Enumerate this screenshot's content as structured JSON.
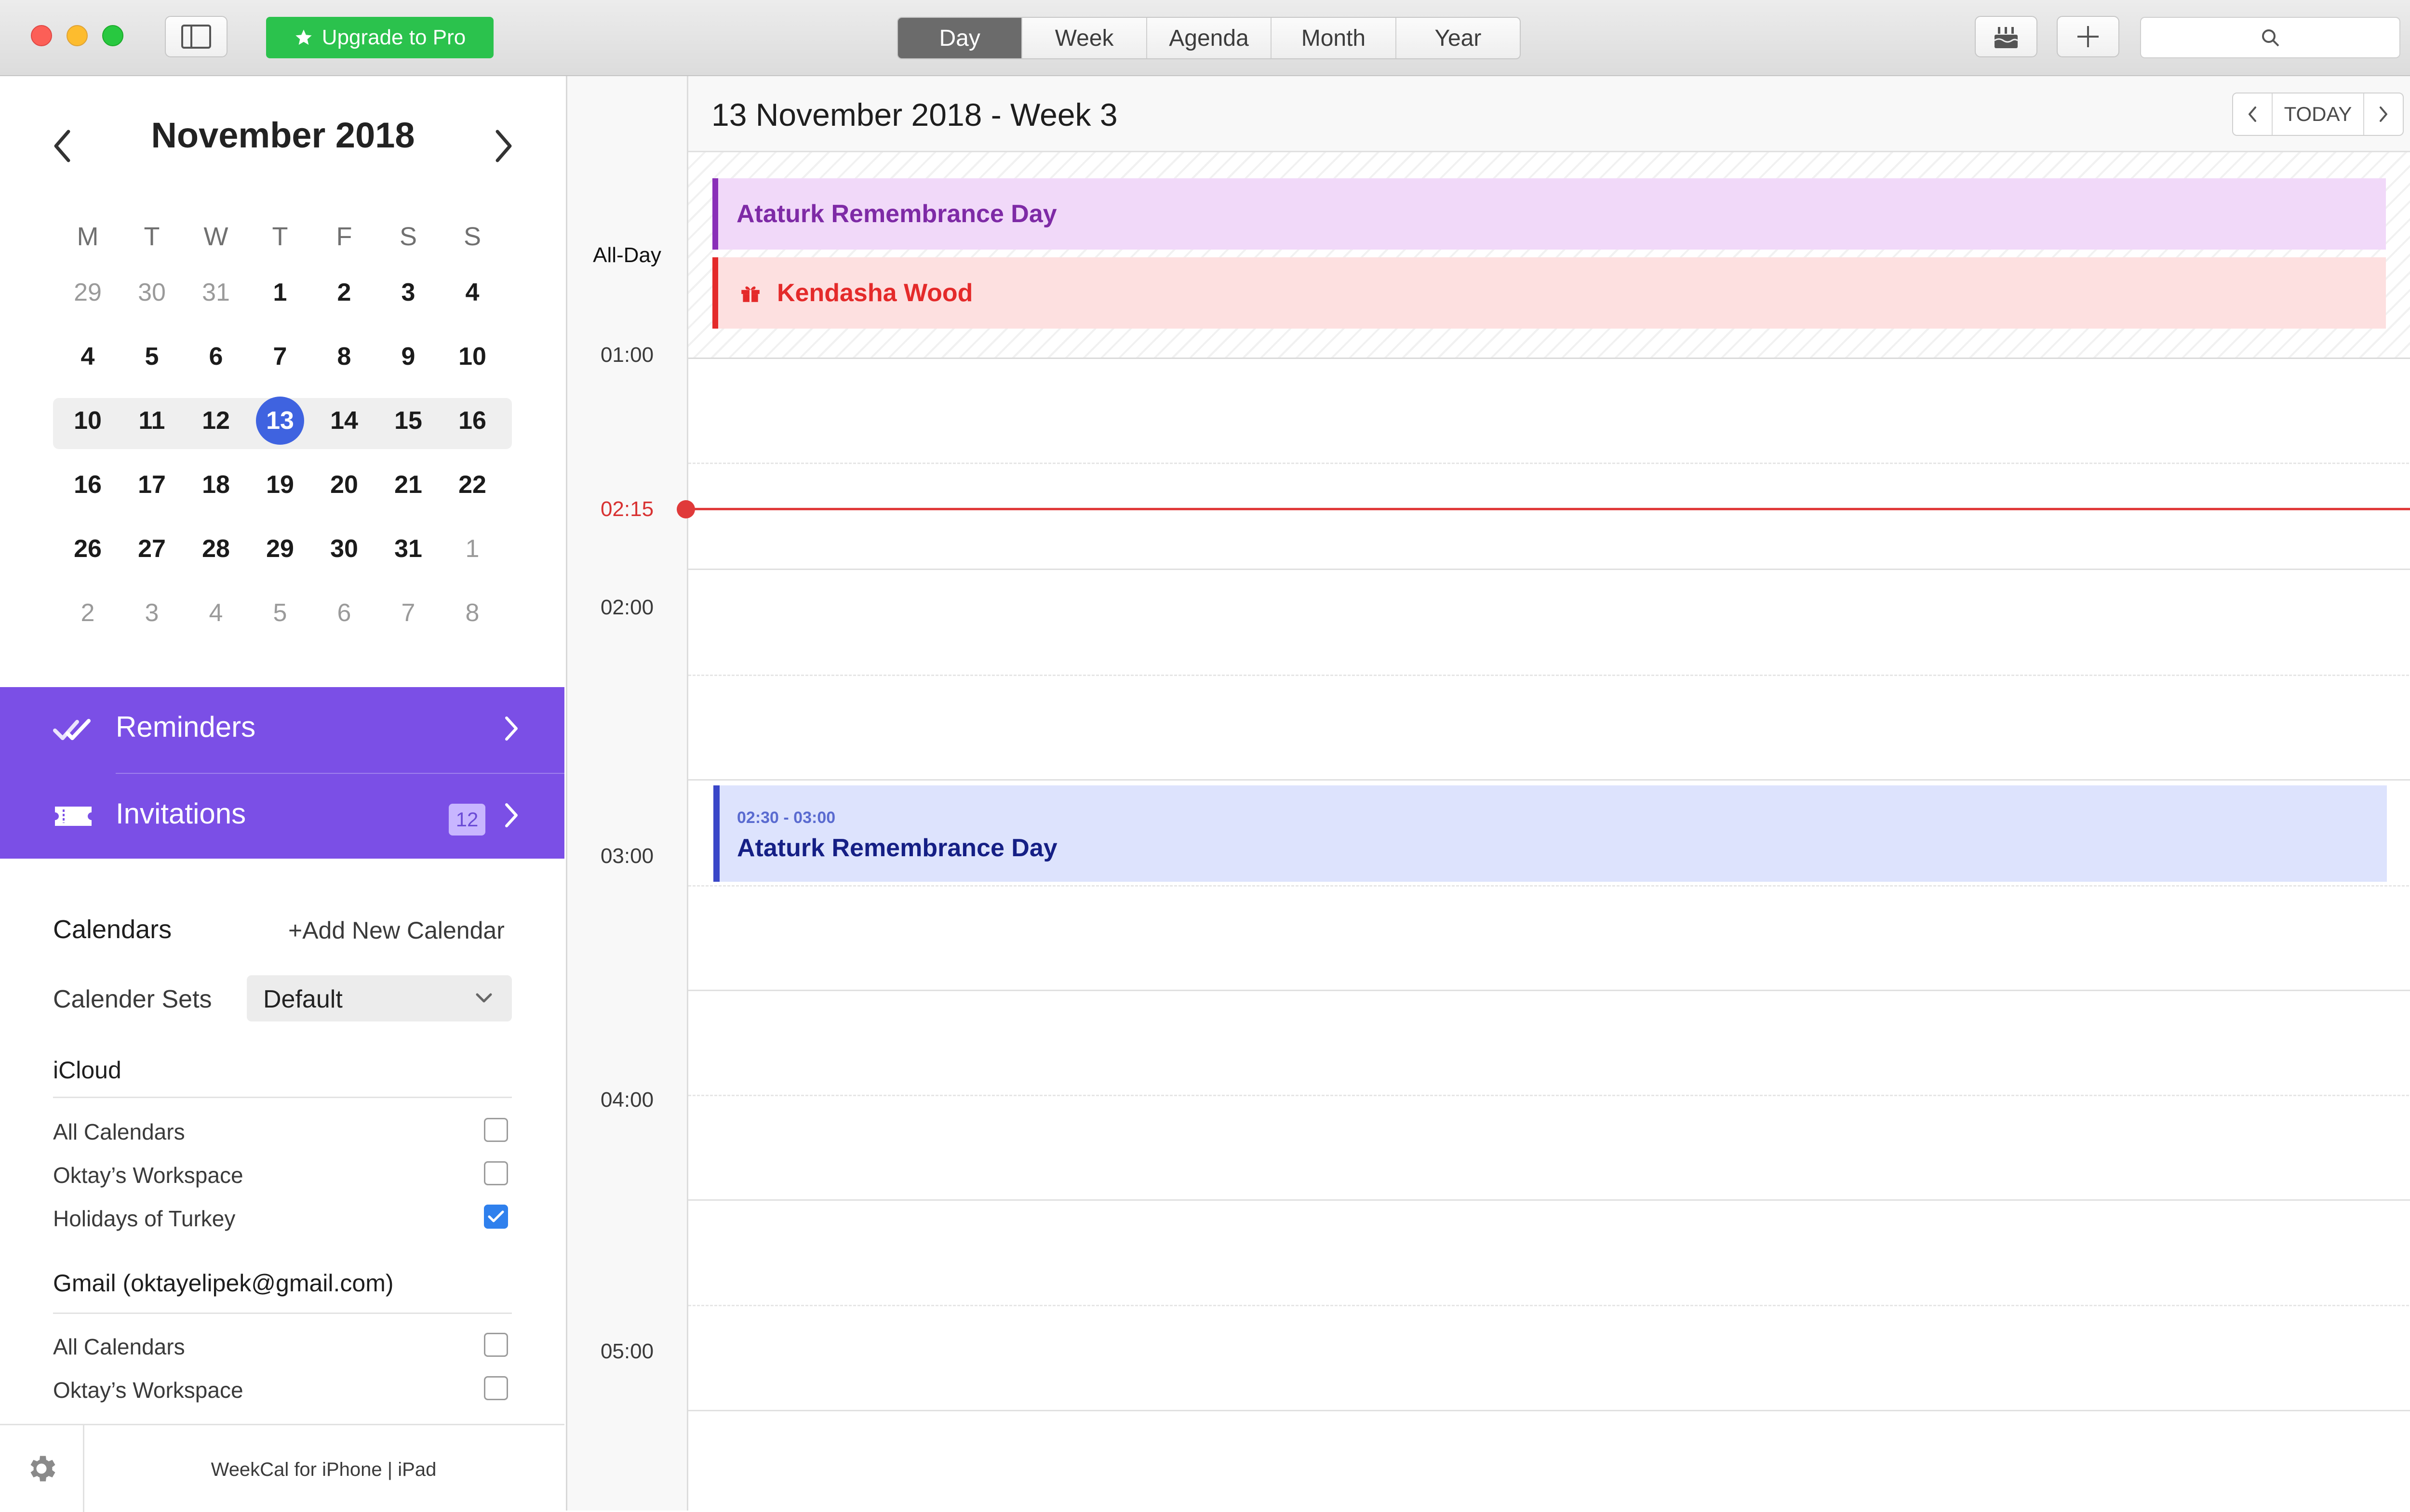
{
  "toolbar": {
    "upgrade_label": "Upgrade to Pro",
    "views": [
      "Day",
      "Week",
      "Agenda",
      "Month",
      "Year"
    ],
    "active_view": "Day"
  },
  "mini_calendar": {
    "title": "November 2018",
    "weekdays": [
      "M",
      "T",
      "W",
      "T",
      "F",
      "S",
      "S"
    ],
    "weeks": [
      [
        "29",
        "30",
        "31",
        "1",
        "2",
        "3",
        "4"
      ],
      [
        "4",
        "5",
        "6",
        "7",
        "8",
        "9",
        "10"
      ],
      [
        "10",
        "11",
        "12",
        "13",
        "14",
        "15",
        "16"
      ],
      [
        "16",
        "17",
        "18",
        "19",
        "20",
        "21",
        "22"
      ],
      [
        "26",
        "27",
        "28",
        "29",
        "30",
        "31",
        "1"
      ],
      [
        "2",
        "3",
        "4",
        "5",
        "6",
        "7",
        "8"
      ]
    ],
    "selected_day": "13"
  },
  "shortcuts": {
    "reminders_label": "Reminders",
    "invitations_label": "Invitations",
    "invitations_count": "12"
  },
  "calendars": {
    "title": "Calendars",
    "add_label": "+Add New Calendar",
    "sets_label": "Calender Sets",
    "sets_value": "Default",
    "accounts": [
      {
        "name": "iCloud",
        "items": [
          {
            "label": "All Calendars",
            "checked": false
          },
          {
            "label": "Oktay’s Workspace",
            "checked": false
          },
          {
            "label": "Holidays of Turkey",
            "checked": true
          }
        ]
      },
      {
        "name": "Gmail (oktayelipek@gmail.com)",
        "items": [
          {
            "label": "All Calendars",
            "checked": false
          },
          {
            "label": "Oktay’s Workspace",
            "checked": false
          }
        ]
      }
    ]
  },
  "footer": {
    "text": "WeekCal for iPhone  |  iPad"
  },
  "day_view": {
    "title": "13 November 2018 - Week 3",
    "today_label": "TODAY",
    "allday_label": "All-Day",
    "allday_events": [
      {
        "title": "Ataturk Remembrance Day",
        "bg": "#f1d9f9",
        "bar": "#8a2fb8",
        "color": "#7e2aa6"
      },
      {
        "title": "Kendasha Wood",
        "bg": "#fde0e0",
        "bar": "#e42a2a",
        "color": "#e42a2a"
      }
    ],
    "hours": [
      "01:00",
      "02:00",
      "03:00",
      "04:00",
      "05:00"
    ],
    "now_time": "02:15",
    "events": [
      {
        "time": "02:30 - 03:00",
        "title": "Ataturk Remembrance Day"
      }
    ]
  },
  "colors": {
    "accent_purple": "#7b4fe6",
    "today_blue": "#3f63e0",
    "now_red": "#e03a3a",
    "upgrade_green": "#2bc24d"
  }
}
